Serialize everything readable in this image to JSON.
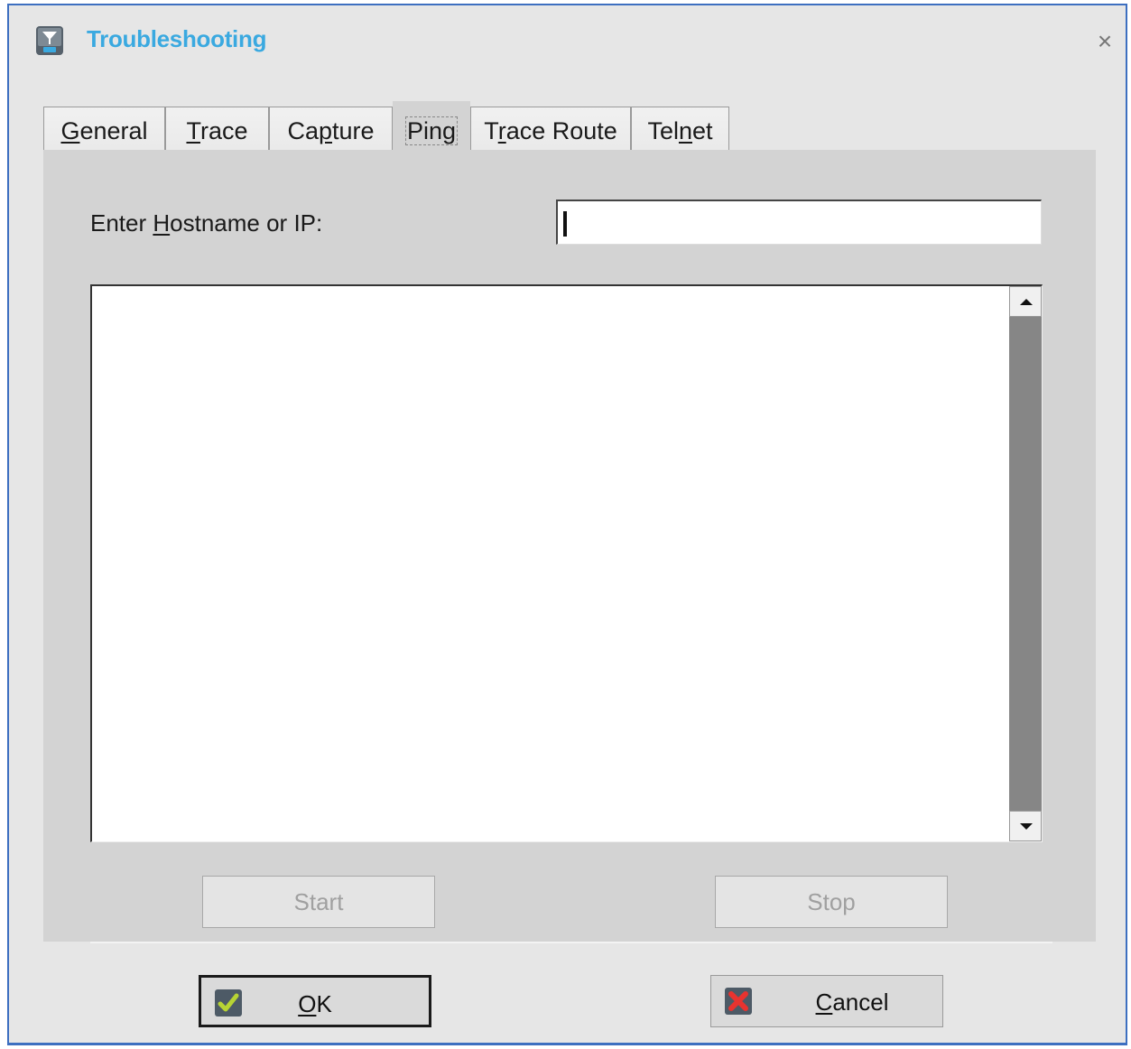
{
  "window": {
    "title": "Troubleshooting",
    "title_color": "#3aa9e0",
    "border_color": "#3d6fc0",
    "icon": "network-icon",
    "close_glyph": "×"
  },
  "tabs": [
    {
      "label": "General",
      "active": false
    },
    {
      "label": "Trace",
      "active": false
    },
    {
      "label": "Capture",
      "active": false
    },
    {
      "label": "Ping",
      "active": true
    },
    {
      "label": "Trace Route",
      "active": false
    },
    {
      "label": "Telnet",
      "active": false
    }
  ],
  "ping": {
    "host_label": "Enter Hostname or IP:",
    "host_value": "",
    "output_text": "",
    "start_label": "Start",
    "stop_label": "Stop"
  },
  "footer": {
    "ok_label": "OK",
    "cancel_label": "Cancel",
    "ok_icon": "check-icon",
    "cancel_icon": "x-mark-icon"
  }
}
